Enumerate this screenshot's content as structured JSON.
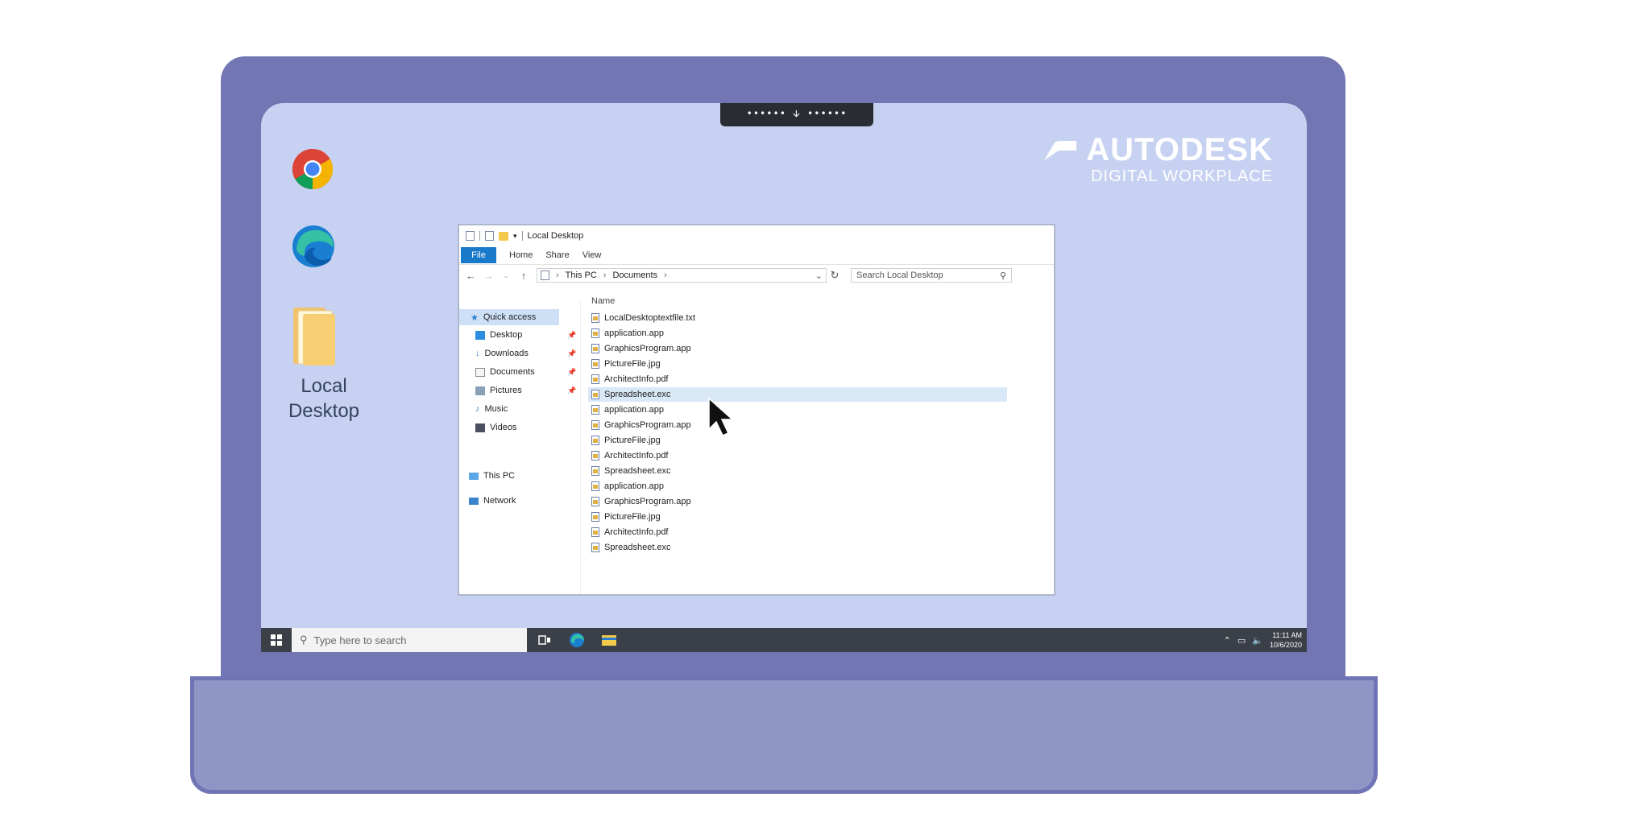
{
  "brand": {
    "name": "AUTODESK",
    "sub": "DIGITAL WORKPLACE"
  },
  "notch": {
    "label": "•••••• 🡫 ••••••"
  },
  "desktop": {
    "icons": [
      {
        "name": "chrome-icon",
        "label": ""
      },
      {
        "name": "edge-icon",
        "label": ""
      },
      {
        "name": "folder-icon",
        "label": "Local Desktop"
      }
    ],
    "folder_label_line1": "Local",
    "folder_label_line2": "Desktop"
  },
  "explorer": {
    "title": "Local Desktop",
    "ribbon": {
      "file": "File",
      "tabs": [
        "Home",
        "Share",
        "View"
      ]
    },
    "address": {
      "segments": [
        "This PC",
        "Documents"
      ]
    },
    "search_placeholder": "Search Local Desktop",
    "nav": {
      "quick_access": "Quick access",
      "items": [
        {
          "label": "Desktop",
          "icon": "desktop-icon",
          "pinned": true
        },
        {
          "label": "Downloads",
          "icon": "download-icon",
          "pinned": true
        },
        {
          "label": "Documents",
          "icon": "documents-icon",
          "pinned": true
        },
        {
          "label": "Pictures",
          "icon": "pictures-icon",
          "pinned": true
        },
        {
          "label": "Music",
          "icon": "music-icon",
          "pinned": false
        },
        {
          "label": "Videos",
          "icon": "videos-icon",
          "pinned": false
        }
      ],
      "this_pc": "This PC",
      "network": "Network"
    },
    "column_header": "Name",
    "files": [
      "LocalDesktoptextfile.txt",
      "application.app",
      "GraphicsProgram.app",
      "PictureFile.jpg",
      "ArchitectInfo.pdf",
      "Spreadsheet.exc",
      "application.app",
      "GraphicsProgram.app",
      "PictureFile.jpg",
      "ArchitectInfo.pdf",
      "Spreadsheet.exc",
      "application.app",
      "GraphicsProgram.app",
      "PictureFile.jpg",
      "ArchitectInfo.pdf",
      "Spreadsheet.exc"
    ],
    "selected_index": 5
  },
  "taskbar": {
    "search_placeholder": "Type here to search",
    "time": "11:11 AM",
    "date": "10/6/2020"
  }
}
